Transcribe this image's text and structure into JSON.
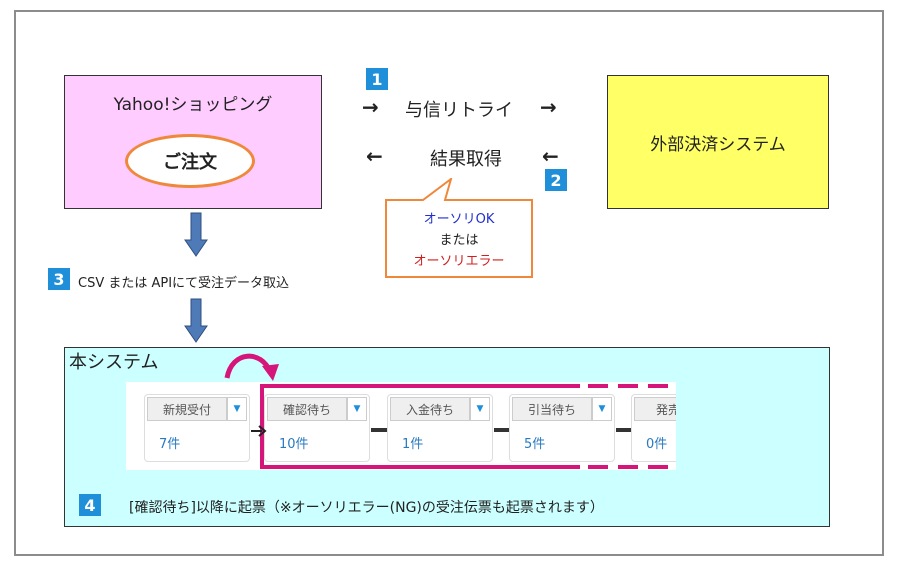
{
  "yahoo": {
    "title": "Yahoo!ショッピング",
    "order": "ご注文"
  },
  "external": {
    "title": "外部決済システム"
  },
  "flow": {
    "step1": {
      "num": "1",
      "label": "与信リトライ",
      "arrow": "→"
    },
    "step2": {
      "num": "2",
      "label": "結果取得",
      "arrow": "←"
    }
  },
  "callout": {
    "line1": "オーソリOK",
    "line2": "または",
    "line3": "オーソリエラー"
  },
  "step3": {
    "num": "3",
    "label": "CSV または APIにて受注データ取込"
  },
  "system": {
    "title": "本システム",
    "statuses": [
      {
        "label": "新規受付",
        "count": "7件"
      },
      {
        "label": "確認待ち",
        "count": "10件"
      },
      {
        "label": "入金待ち",
        "count": "1件"
      },
      {
        "label": "引当待ち",
        "count": "5件"
      },
      {
        "label": "発売日",
        "count": "0件"
      }
    ]
  },
  "step4": {
    "num": "4",
    "label": "[確認待ち]以降に起票（※オーソリエラー(NG)の受注伝票も起票されます）"
  },
  "colors": {
    "accent_blue": "#1e8fd8",
    "magenta": "#d6157a",
    "orange": "#f0883c"
  }
}
